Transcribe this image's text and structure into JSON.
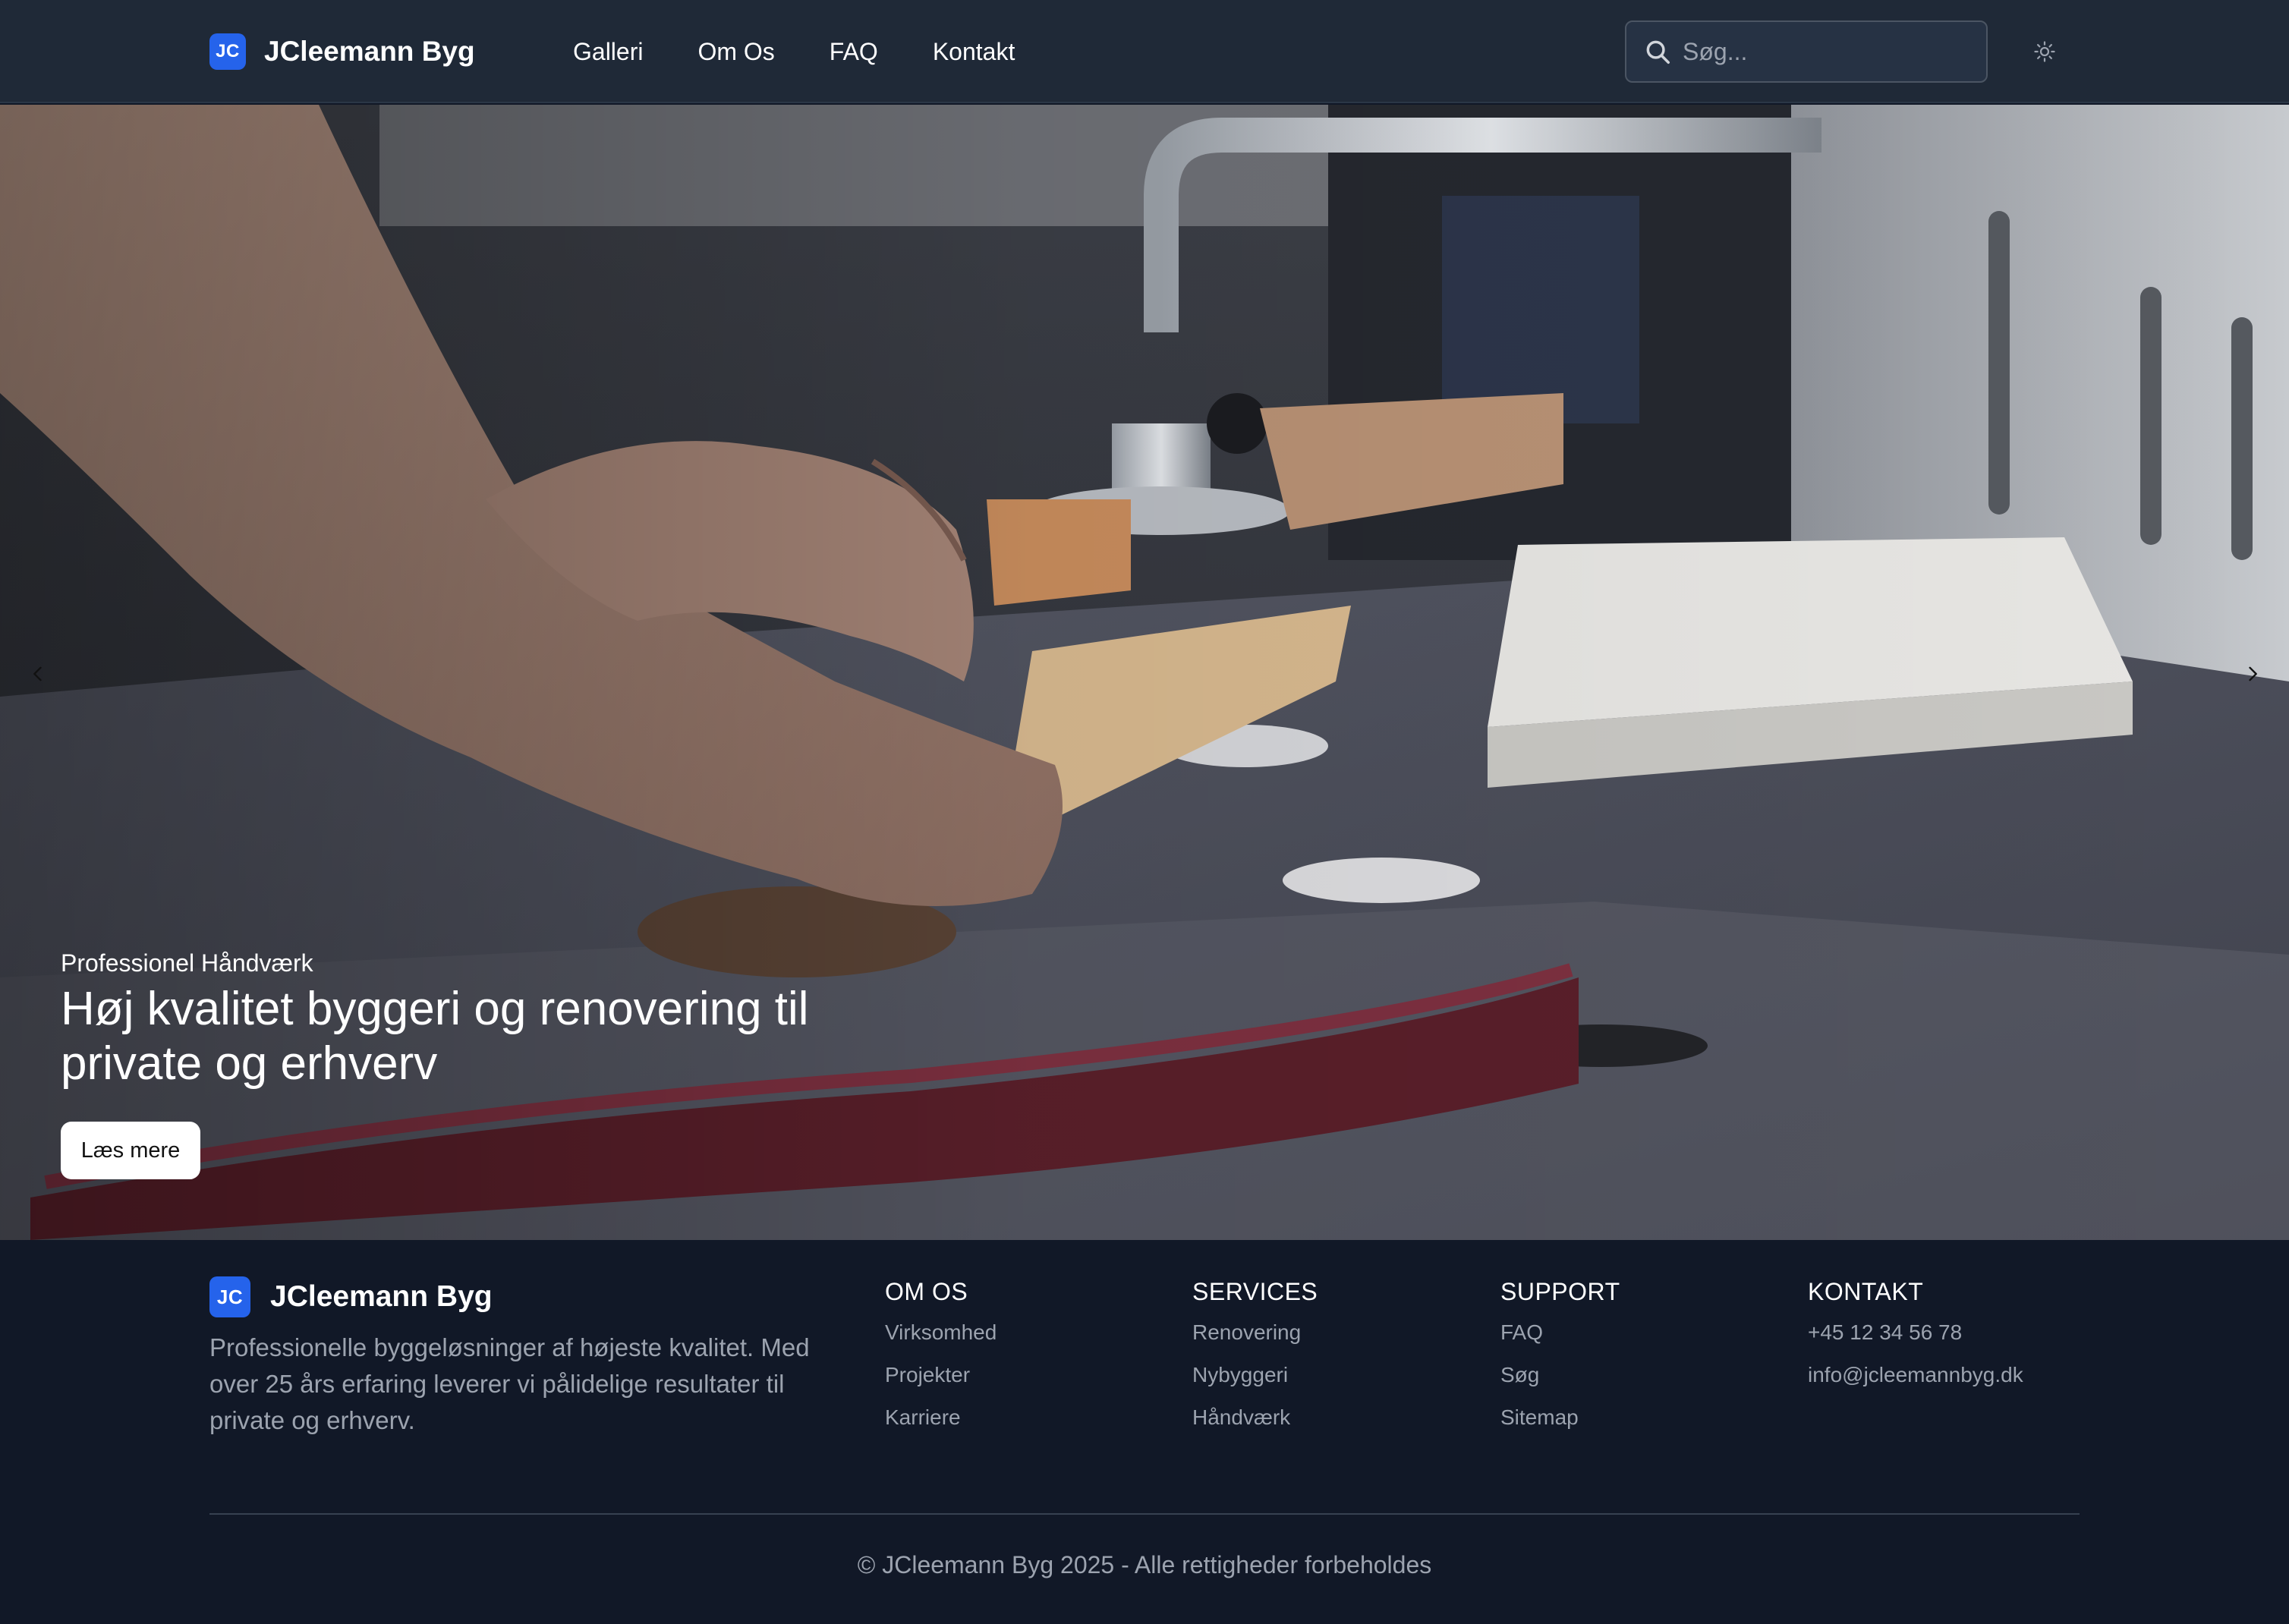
{
  "header": {
    "logo_initials": "JC",
    "brand": "JCleemann Byg",
    "nav": [
      "Galleri",
      "Om Os",
      "FAQ",
      "Kontakt"
    ],
    "search_placeholder": "Søg...",
    "theme_toggle_icon": "sun-icon"
  },
  "hero": {
    "eyebrow": "Professionel Håndværk",
    "title": "Høj kvalitet byggeri og renovering til private og erhverv",
    "button": "Læs mere",
    "prev_icon": "chevron-left-icon",
    "next_icon": "chevron-right-icon"
  },
  "footer": {
    "logo_initials": "JC",
    "brand": "JCleemann Byg",
    "description": "Professionelle byggeløsninger af højeste kvalitet. Med over 25 års erfaring leverer vi pålidelige resultater til private og erhverv.",
    "columns": [
      {
        "title": "OM OS",
        "links": [
          "Virksomhed",
          "Projekter",
          "Karriere"
        ]
      },
      {
        "title": "SERVICES",
        "links": [
          "Renovering",
          "Nybyggeri",
          "Håndværk"
        ]
      },
      {
        "title": "SUPPORT",
        "links": [
          "FAQ",
          "Søg",
          "Sitemap"
        ]
      },
      {
        "title": "KONTAKT",
        "links": [
          "+45 12 34 56 78",
          "info@jcleemannbyg.dk"
        ]
      }
    ],
    "copyright": "© JCleemann Byg 2025 - Alle rettigheder forbeholdes"
  },
  "colors": {
    "header_bg": "#1f2937",
    "footer_bg": "#111827",
    "accent": "#2563eb",
    "muted_text": "#9ca3af"
  }
}
